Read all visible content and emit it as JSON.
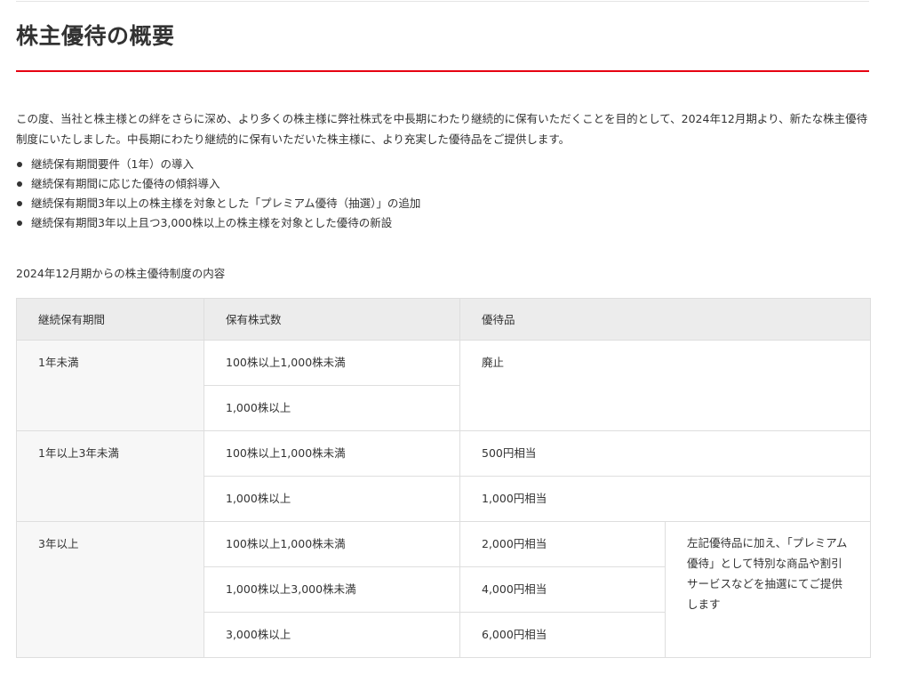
{
  "section": {
    "title": "株主優待の概要",
    "intro": "この度、当社と株主様との絆をさらに深め、より多くの株主様に弊社株式を中長期にわたり継続的に保有いただくことを目的として、2024年12月期より、新たな株主優待制度にいたしました。中長期にわたり継続的に保有いただいた株主様に、より充実した優待品をご提供します。",
    "bullets": [
      "継続保有期間要件（1年）の導入",
      "継続保有期間に応じた優待の傾斜導入",
      "継続保有期間3年以上の株主様を対象とした「プレミアム優待（抽選）」の追加",
      "継続保有期間3年以上且つ3,000株以上の株主様を対象とした優待の新設"
    ],
    "table_caption": "2024年12月期からの株主優待制度の内容"
  },
  "table": {
    "headers": [
      "継続保有期間",
      "保有株式数",
      "優待品"
    ],
    "groups": [
      {
        "period": "1年未満",
        "rows": [
          {
            "shares": "100株以上1,000株未満",
            "benefit": "廃止"
          },
          {
            "shares": "1,000株以上",
            "benefit": ""
          }
        ]
      },
      {
        "period": "1年以上3年未満",
        "rows": [
          {
            "shares": "100株以上1,000株未満",
            "benefit": "500円相当"
          },
          {
            "shares": "1,000株以上",
            "benefit": "1,000円相当"
          }
        ]
      },
      {
        "period": "3年以上",
        "rows": [
          {
            "shares": "100株以上1,000株未満",
            "benefit": "2,000円相当"
          },
          {
            "shares": "1,000株以上3,000株未満",
            "benefit": "4,000円相当"
          },
          {
            "shares": "3,000株以上",
            "benefit": "6,000円相当"
          }
        ],
        "note": "左記優待品に加え､「プレミアム優待」として特別な商品や割引サービスなどを抽選にてご提供します"
      }
    ]
  },
  "colors": {
    "accent": "#e60012",
    "header_bg": "#ececec",
    "period_bg": "#f7f7f7",
    "border": "#dedede",
    "text": "#333333"
  }
}
